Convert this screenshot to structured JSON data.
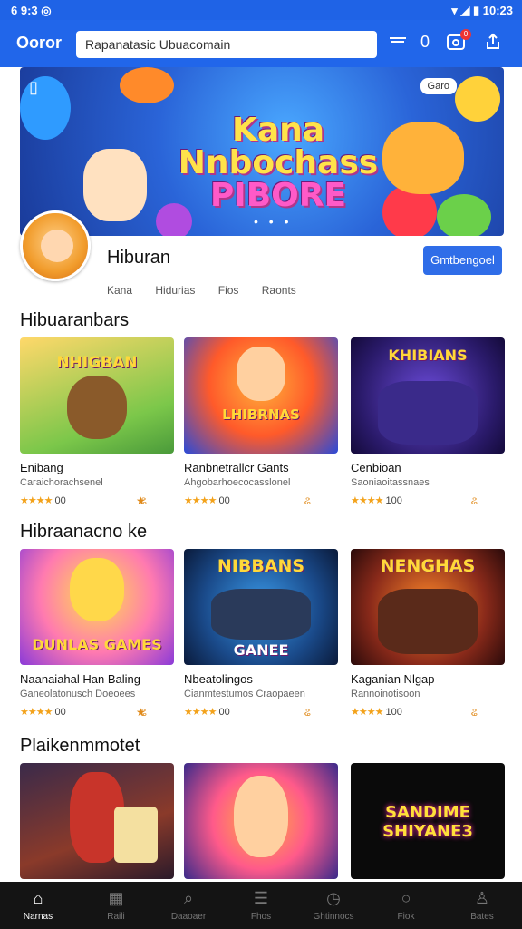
{
  "status": {
    "left": "6 9:3 ◎",
    "right": "▾ ◢ ▮ 10:23"
  },
  "header": {
    "logo": "Ooror",
    "search_value": "Rapanatasic Ubuacomain",
    "icons": [
      "cast-icon",
      "zero-count",
      "inbox-icon",
      "share-icon"
    ],
    "count": "0",
    "badge": "0"
  },
  "hero": {
    "title_line1": "Kana",
    "title_line2": "Nnbochass",
    "title_line3": "PIBORE",
    "chip": "Garo",
    "dots": "• • •"
  },
  "profile": {
    "name": "Hiburan",
    "button": "Gmtbengoel",
    "tabs": [
      "Kana",
      "Hidurias",
      "Fios",
      "Raonts"
    ]
  },
  "sections": [
    {
      "title": "Hibuaranbars",
      "cards": [
        {
          "art": "NHIGBAN",
          "title": "Enibang",
          "sub": "Caraichorachsenel",
          "rating": "★★★★",
          "count": "00",
          "tag": "ଌ",
          "tag2": "★"
        },
        {
          "art": "LHIBRNAS",
          "title": "Ranbnetrallcr Gants",
          "sub": "Ahgobarhoecocasslonel",
          "rating": "★★★★",
          "count": "00",
          "tag": "ଌ",
          "tag2": ""
        },
        {
          "art": "KHIBIANS",
          "title": "Cenbioan",
          "sub": "Saoniaoitassnaes",
          "rating": "★★★★",
          "count": "100",
          "tag": "ଌ",
          "tag2": ""
        }
      ]
    },
    {
      "title": "Hibraanacno ke",
      "cards": [
        {
          "art": "DUNLAS GAMES",
          "title": "Naanaiahal Han Baling",
          "sub": "Ganeolatonusch Doeoees",
          "rating": "★★★★",
          "count": "00",
          "tag": "ଌ",
          "tag2": "★"
        },
        {
          "art": "NIBBANS",
          "title": "Nbeatolingos",
          "sub": "Cianmtestumos Craopaeen",
          "rating": "★★★★",
          "count": "00",
          "tag": "ଌ",
          "tag2": ""
        },
        {
          "art": "NENGHAS",
          "title": "Kaganian Nlgap",
          "sub": "Rannoinotisoon",
          "rating": "★★★★",
          "count": "100",
          "tag": "ଌ",
          "tag2": ""
        }
      ]
    },
    {
      "title": "Plaikenmmotet",
      "cards": [
        {
          "art": "",
          "title": "",
          "sub": "",
          "rating": "",
          "count": "",
          "tag": "",
          "tag2": ""
        },
        {
          "art": "",
          "title": "",
          "sub": "",
          "rating": "",
          "count": "",
          "tag": "",
          "tag2": ""
        },
        {
          "art": "SANDIME SHIYANE3",
          "title": "",
          "sub": "",
          "rating": "",
          "count": "",
          "tag": "",
          "tag2": ""
        }
      ]
    }
  ],
  "nav": [
    {
      "label": "Narnas",
      "icon": "home-icon"
    },
    {
      "label": "Raili",
      "icon": "store-icon"
    },
    {
      "label": "Daaoaer",
      "icon": "search-icon"
    },
    {
      "label": "Fhos",
      "icon": "list-icon"
    },
    {
      "label": "Ghtinnocs",
      "icon": "clock-icon"
    },
    {
      "label": "Fiok",
      "icon": "chat-icon"
    },
    {
      "label": "Bates",
      "icon": "profile-icon"
    }
  ],
  "colors": {
    "primary": "#2166ea",
    "nav_bg": "#141414",
    "star": "#f3a21a"
  }
}
